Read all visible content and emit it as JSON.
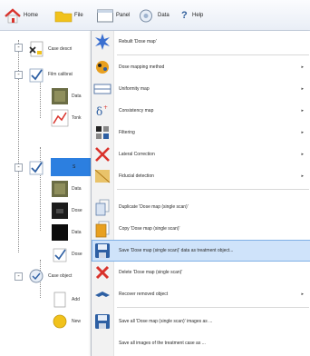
{
  "toolbar": {
    "home_label": "Home",
    "file_label": "File",
    "panel_label": "Panel",
    "data_label": "Data",
    "help_label": "Help"
  },
  "tree": {
    "items": [
      {
        "label": "Case descri"
      },
      {
        "label": "Film calibrat"
      },
      {
        "label": "Data"
      },
      {
        "label": "Tonk"
      },
      {
        "label": "S"
      },
      {
        "label": "Data"
      },
      {
        "label": "Dose"
      },
      {
        "label": "Data"
      },
      {
        "label": "Dose"
      },
      {
        "label": "Case object"
      },
      {
        "label": "Add"
      },
      {
        "label": "New"
      }
    ]
  },
  "menu": {
    "items": [
      {
        "label": "Rebuilt 'Dose map'",
        "icon": "rebuild-icon",
        "submenu": false
      },
      {
        "label": "Dose mapping method",
        "icon": "dose-mapping-icon",
        "submenu": true
      },
      {
        "label": "Uniformity map",
        "icon": "uniformity-map-icon",
        "submenu": true
      },
      {
        "label": "Consistency map",
        "icon": "consistency-map-icon",
        "submenu": true
      },
      {
        "label": "Filtering",
        "icon": "filtering-icon",
        "submenu": true
      },
      {
        "label": "Lateral Correction",
        "icon": "lateral-correction-icon",
        "submenu": true
      },
      {
        "label": "Fiducial detection",
        "icon": "fiducial-detection-icon",
        "submenu": true
      },
      {
        "label": "Duplicate 'Dose map (single scan)'",
        "icon": "duplicate-icon",
        "submenu": false
      },
      {
        "label": "Copy 'Dose map (single scan)'",
        "icon": "copy-icon",
        "submenu": false
      },
      {
        "label": "Save 'Dose map (single scan)' data as treatment object...",
        "icon": "save-icon",
        "submenu": false,
        "highlighted": true
      },
      {
        "label": "Delete 'Dose map (single scan)'",
        "icon": "delete-icon",
        "submenu": false
      },
      {
        "label": "Recover removed object",
        "icon": "recover-icon",
        "submenu": true
      },
      {
        "label": "Save all 'Dose map (single scan)' images as ...",
        "icon": "save-all-icon",
        "submenu": false
      },
      {
        "label": "Save all images of the treatment case as ...",
        "icon": "",
        "submenu": false
      }
    ]
  },
  "colors": {
    "selection": "#2c7fe0",
    "menu_highlight": "#cfe3fa",
    "gutter": "#f2f2f2",
    "home_red": "#d9322b",
    "folder_yellow": "#f1c21b"
  }
}
